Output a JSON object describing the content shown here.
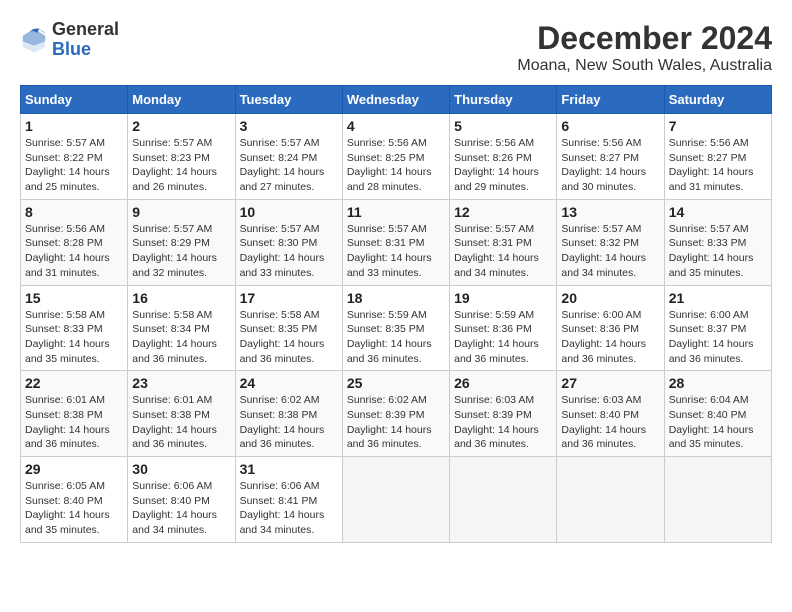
{
  "logo": {
    "general": "General",
    "blue": "Blue"
  },
  "title": "December 2024",
  "subtitle": "Moana, New South Wales, Australia",
  "weekdays": [
    "Sunday",
    "Monday",
    "Tuesday",
    "Wednesday",
    "Thursday",
    "Friday",
    "Saturday"
  ],
  "weeks": [
    [
      {
        "day": "1",
        "sunrise": "5:57 AM",
        "sunset": "8:22 PM",
        "daylight": "14 hours and 25 minutes."
      },
      {
        "day": "2",
        "sunrise": "5:57 AM",
        "sunset": "8:23 PM",
        "daylight": "14 hours and 26 minutes."
      },
      {
        "day": "3",
        "sunrise": "5:57 AM",
        "sunset": "8:24 PM",
        "daylight": "14 hours and 27 minutes."
      },
      {
        "day": "4",
        "sunrise": "5:56 AM",
        "sunset": "8:25 PM",
        "daylight": "14 hours and 28 minutes."
      },
      {
        "day": "5",
        "sunrise": "5:56 AM",
        "sunset": "8:26 PM",
        "daylight": "14 hours and 29 minutes."
      },
      {
        "day": "6",
        "sunrise": "5:56 AM",
        "sunset": "8:27 PM",
        "daylight": "14 hours and 30 minutes."
      },
      {
        "day": "7",
        "sunrise": "5:56 AM",
        "sunset": "8:27 PM",
        "daylight": "14 hours and 31 minutes."
      }
    ],
    [
      {
        "day": "8",
        "sunrise": "5:56 AM",
        "sunset": "8:28 PM",
        "daylight": "14 hours and 31 minutes."
      },
      {
        "day": "9",
        "sunrise": "5:57 AM",
        "sunset": "8:29 PM",
        "daylight": "14 hours and 32 minutes."
      },
      {
        "day": "10",
        "sunrise": "5:57 AM",
        "sunset": "8:30 PM",
        "daylight": "14 hours and 33 minutes."
      },
      {
        "day": "11",
        "sunrise": "5:57 AM",
        "sunset": "8:31 PM",
        "daylight": "14 hours and 33 minutes."
      },
      {
        "day": "12",
        "sunrise": "5:57 AM",
        "sunset": "8:31 PM",
        "daylight": "14 hours and 34 minutes."
      },
      {
        "day": "13",
        "sunrise": "5:57 AM",
        "sunset": "8:32 PM",
        "daylight": "14 hours and 34 minutes."
      },
      {
        "day": "14",
        "sunrise": "5:57 AM",
        "sunset": "8:33 PM",
        "daylight": "14 hours and 35 minutes."
      }
    ],
    [
      {
        "day": "15",
        "sunrise": "5:58 AM",
        "sunset": "8:33 PM",
        "daylight": "14 hours and 35 minutes."
      },
      {
        "day": "16",
        "sunrise": "5:58 AM",
        "sunset": "8:34 PM",
        "daylight": "14 hours and 36 minutes."
      },
      {
        "day": "17",
        "sunrise": "5:58 AM",
        "sunset": "8:35 PM",
        "daylight": "14 hours and 36 minutes."
      },
      {
        "day": "18",
        "sunrise": "5:59 AM",
        "sunset": "8:35 PM",
        "daylight": "14 hours and 36 minutes."
      },
      {
        "day": "19",
        "sunrise": "5:59 AM",
        "sunset": "8:36 PM",
        "daylight": "14 hours and 36 minutes."
      },
      {
        "day": "20",
        "sunrise": "6:00 AM",
        "sunset": "8:36 PM",
        "daylight": "14 hours and 36 minutes."
      },
      {
        "day": "21",
        "sunrise": "6:00 AM",
        "sunset": "8:37 PM",
        "daylight": "14 hours and 36 minutes."
      }
    ],
    [
      {
        "day": "22",
        "sunrise": "6:01 AM",
        "sunset": "8:38 PM",
        "daylight": "14 hours and 36 minutes."
      },
      {
        "day": "23",
        "sunrise": "6:01 AM",
        "sunset": "8:38 PM",
        "daylight": "14 hours and 36 minutes."
      },
      {
        "day": "24",
        "sunrise": "6:02 AM",
        "sunset": "8:38 PM",
        "daylight": "14 hours and 36 minutes."
      },
      {
        "day": "25",
        "sunrise": "6:02 AM",
        "sunset": "8:39 PM",
        "daylight": "14 hours and 36 minutes."
      },
      {
        "day": "26",
        "sunrise": "6:03 AM",
        "sunset": "8:39 PM",
        "daylight": "14 hours and 36 minutes."
      },
      {
        "day": "27",
        "sunrise": "6:03 AM",
        "sunset": "8:40 PM",
        "daylight": "14 hours and 36 minutes."
      },
      {
        "day": "28",
        "sunrise": "6:04 AM",
        "sunset": "8:40 PM",
        "daylight": "14 hours and 35 minutes."
      }
    ],
    [
      {
        "day": "29",
        "sunrise": "6:05 AM",
        "sunset": "8:40 PM",
        "daylight": "14 hours and 35 minutes."
      },
      {
        "day": "30",
        "sunrise": "6:06 AM",
        "sunset": "8:40 PM",
        "daylight": "14 hours and 34 minutes."
      },
      {
        "day": "31",
        "sunrise": "6:06 AM",
        "sunset": "8:41 PM",
        "daylight": "14 hours and 34 minutes."
      },
      null,
      null,
      null,
      null
    ]
  ],
  "labels": {
    "sunrise": "Sunrise:",
    "sunset": "Sunset:",
    "daylight": "Daylight:"
  }
}
